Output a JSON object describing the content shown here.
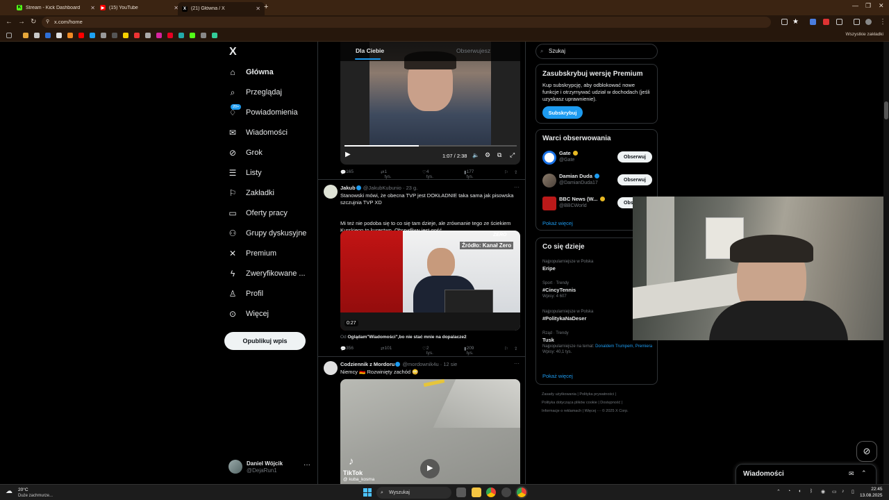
{
  "browser": {
    "tabs": [
      {
        "title": "Stream - Kick Dashboard",
        "favicon": "kick-icon",
        "color": "#53fc18"
      },
      {
        "title": "(15) YouTube",
        "favicon": "youtube-icon",
        "color": "#ff0000"
      },
      {
        "title": "(21) Główna / X",
        "favicon": "x-icon",
        "color": "#000000"
      }
    ],
    "new_tab": "+",
    "url": "x.com/home",
    "all_bookmarks": "Wszystkie zakładki"
  },
  "nav": {
    "logo": "X",
    "items": [
      {
        "label": "Główna",
        "icon": "home-icon",
        "glyph": "⌂"
      },
      {
        "label": "Przeglądaj",
        "icon": "search-icon",
        "glyph": "⌕"
      },
      {
        "label": "Powiadomienia",
        "icon": "bell-icon",
        "glyph": "♢",
        "badge": "20+"
      },
      {
        "label": "Wiadomości",
        "icon": "mail-icon",
        "glyph": "✉"
      },
      {
        "label": "Grok",
        "icon": "grok-icon",
        "glyph": "⊘"
      },
      {
        "label": "Listy",
        "icon": "list-icon",
        "glyph": "☰"
      },
      {
        "label": "Zakładki",
        "icon": "bookmark-icon",
        "glyph": "⚐"
      },
      {
        "label": "Oferty pracy",
        "icon": "briefcase-icon",
        "glyph": "▭"
      },
      {
        "label": "Grupy dyskusyjne",
        "icon": "people-icon",
        "glyph": "⚇"
      },
      {
        "label": "Premium",
        "icon": "x-premium-icon",
        "glyph": "✕"
      },
      {
        "label": "Zweryfikowane ...",
        "icon": "lightning-icon",
        "glyph": "ϟ"
      },
      {
        "label": "Profil",
        "icon": "person-icon",
        "glyph": "♙"
      },
      {
        "label": "Więcej",
        "icon": "more-circle-icon",
        "glyph": "⊙"
      }
    ],
    "post_button": "Opublikuj wpis",
    "account": {
      "name": "Daniel Wójcik",
      "handle": "@DejaRun1",
      "more": "···"
    }
  },
  "timeline": {
    "tab_for_you": "Dla Ciebie",
    "tab_following": "Obserwujesz",
    "tweet0": {
      "video_time": "1:07 / 2:38",
      "replies": "165",
      "reposts": "1 tys.",
      "likes": "4 tys.",
      "views": "177 tys."
    },
    "tweet1": {
      "name": "Jakub",
      "handle": "@JakubKubunio · 23 g.",
      "text1": "Stanowski mówi, że obecna TVP jest DOKŁADNIE taka sama jak pisowska szczujnia TVP XD",
      "text2": "Mi też nie podoba się to co się tam dzieje, ale zrównanie tego ze ściekiem Kurskiego to kurestwo. Obrzydliwy jest gość.",
      "media_label": "Źródło: Kanał Zero",
      "media_logo": "ZERO",
      "duration": "0:27",
      "quote_from": "Od",
      "quote": "Oglądam\"Wiadomości\",bo nie stać mnie na dopalacze2",
      "replies": "356",
      "reposts": "101",
      "likes": "2 tys.",
      "views": "209 tys."
    },
    "tweet2": {
      "name": "Codziennik z Mordoru",
      "handle": "@mordownik4u · 12 sie",
      "text": "Niemcy 🇩🇪 Rozwinięty zachód 😳",
      "tiktok_label": "TikTok",
      "tiktok_user": "@ kuba_kosma"
    }
  },
  "sidebar": {
    "search_placeholder": "Szukaj",
    "premium": {
      "title": "Zasubskrybuj wersję Premium",
      "text": "Kup subskrypcję, aby odblokować nowe funkcje i otrzymywać udział w dochodach (jeśli uzyskasz uprawnienie).",
      "button": "Subskrybuj"
    },
    "who_to_follow": {
      "title": "Warci obserwowania",
      "accounts": [
        {
          "name": "Gate",
          "handle": "@Gate",
          "button": "Obserwuj"
        },
        {
          "name": "Damian Duda",
          "handle": "@DamianDuda17",
          "button": "Obserwuj"
        },
        {
          "name": "BBC News (W...",
          "handle": "@BBCWorld",
          "button": "Obserwuj"
        }
      ],
      "show_more": "Pokaż więcej"
    },
    "trends": {
      "title": "Co się dzieje",
      "items": [
        {
          "context": "Najpopularniejsze w Polska",
          "topic": "Eripe",
          "sub": ""
        },
        {
          "context": "Sport · Trendy",
          "topic": "#CincyTennis",
          "sub": "Wpisy: 4 607"
        },
        {
          "context": "Najpopularniejsze w Polska",
          "topic": "#PolitykaNaDeser",
          "sub": ""
        },
        {
          "context": "Rząd · Trendy",
          "topic": "Tusk",
          "sub": "Wpisy: 40,1 tys."
        }
      ],
      "tusk_context": "Najpopularniejsze na temat:",
      "tusk_links": "Donaldem Trumpem, Premiera",
      "show_more": "Pokaż więcej"
    },
    "footer": {
      "line1": "Zasady użytkowania  |  Polityka prywatności  |",
      "line2": "Polityka dotycząca plików cookie  |  Dostępność  |",
      "line3": "Informacje o reklamach  |  Więcej ···  © 2025 X Corp."
    }
  },
  "messages_drawer": {
    "title": "Wiadomości"
  },
  "taskbar": {
    "weather_temp": "20°C",
    "weather_desc": "Duże zachmurze...",
    "search": "Wyszukaj",
    "time": "22:45",
    "date": "13.08.2025"
  },
  "colors": {
    "accent": "#1d9bf0",
    "background": "#000000",
    "browser_frame": "#26170c"
  }
}
